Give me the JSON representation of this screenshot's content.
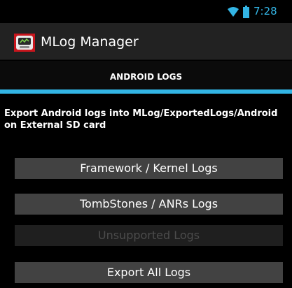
{
  "status_bar": {
    "time": "7:28",
    "icons": [
      "wifi-icon",
      "battery-icon"
    ],
    "accent_color": "#33b5e5"
  },
  "action_bar": {
    "app_icon": "mlog-app-icon",
    "title": "MLog Manager"
  },
  "tabs": [
    {
      "label": "ANDROID LOGS",
      "selected": true
    }
  ],
  "content": {
    "description": "Export Android logs into MLog/ExportedLogs/Android on External SD card",
    "buttons": [
      {
        "label": "Framework / Kernel Logs",
        "enabled": true
      },
      {
        "label": "TombStones / ANRs Logs",
        "enabled": true
      },
      {
        "label": "Unsupported Logs",
        "enabled": false
      },
      {
        "label": "Export All Logs",
        "enabled": true
      }
    ]
  }
}
